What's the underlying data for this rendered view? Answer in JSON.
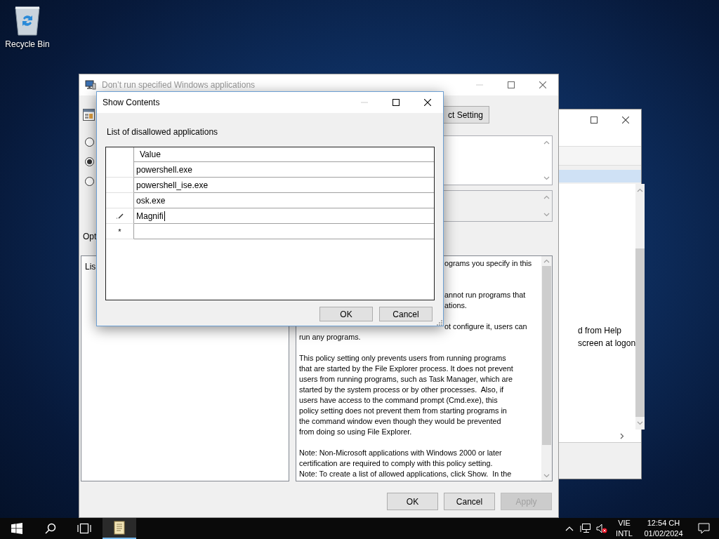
{
  "desktop_icons": [
    {
      "label": "Recycle Bin"
    }
  ],
  "background_window": {
    "items": [
      {
        "text": "d from Help"
      },
      {
        "text": "screen at logon"
      }
    ]
  },
  "policy_window": {
    "title": "Don’t run specified Windows applications",
    "active": false,
    "next_button": "ct Setting",
    "radios": [
      {
        "selected": false
      },
      {
        "selected": true
      },
      {
        "selected": false
      }
    ],
    "options_label": "Opt",
    "options_text": "Lis",
    "help_lines": [
      {
        "kind": "clipped",
        "text": "ograms you specify in this"
      },
      {
        "kind": "gap"
      },
      {
        "kind": "gap"
      },
      {
        "kind": "clipped",
        "text": "annot run programs that"
      },
      {
        "kind": "clipped",
        "text": "ations."
      },
      {
        "kind": "gap"
      },
      {
        "kind": "clipped",
        "text": "ot configure it, users can"
      },
      {
        "kind": "full",
        "text": "run any programs."
      },
      {
        "kind": "gap"
      },
      {
        "kind": "full",
        "text": "This policy setting only prevents users from running programs"
      },
      {
        "kind": "full",
        "text": "that are started by the File Explorer process. It does not prevent"
      },
      {
        "kind": "full",
        "text": "users from running programs, such as Task Manager, which are"
      },
      {
        "kind": "full",
        "text": "started by the system process or by other processes.  Also, if"
      },
      {
        "kind": "full",
        "text": "users have access to the command prompt (Cmd.exe), this"
      },
      {
        "kind": "full",
        "text": "policy setting does not prevent them from starting programs in"
      },
      {
        "kind": "full",
        "text": "the command window even though they would be prevented"
      },
      {
        "kind": "full",
        "text": "from doing so using File Explorer."
      },
      {
        "kind": "gap"
      },
      {
        "kind": "full",
        "text": "Note: Non-Microsoft applications with Windows 2000 or later"
      },
      {
        "kind": "full",
        "text": "certification are required to comply with this policy setting."
      },
      {
        "kind": "full",
        "text": "Note: To create a list of allowed applications, click Show.  In the"
      }
    ],
    "buttons": [
      {
        "label": "OK",
        "disabled": false
      },
      {
        "label": "Cancel",
        "disabled": false
      },
      {
        "label": "Apply",
        "disabled": true
      }
    ]
  },
  "show_contents": {
    "title": "Show Contents",
    "label": "List of disallowed applications",
    "column": "Value",
    "rows": [
      {
        "kind": "entry",
        "value": "powershell.exe"
      },
      {
        "kind": "entry",
        "value": "powershell_ise.exe"
      },
      {
        "kind": "entry",
        "value": "osk.exe"
      },
      {
        "kind": "editing",
        "value": "Magnifi"
      },
      {
        "kind": "new",
        "marker": "*"
      }
    ],
    "buttons": [
      "OK",
      "Cancel"
    ]
  },
  "taskbar": {
    "language": "VIE",
    "layout": "INTL",
    "time": "12:54 CH",
    "date": "01/02/2024"
  }
}
